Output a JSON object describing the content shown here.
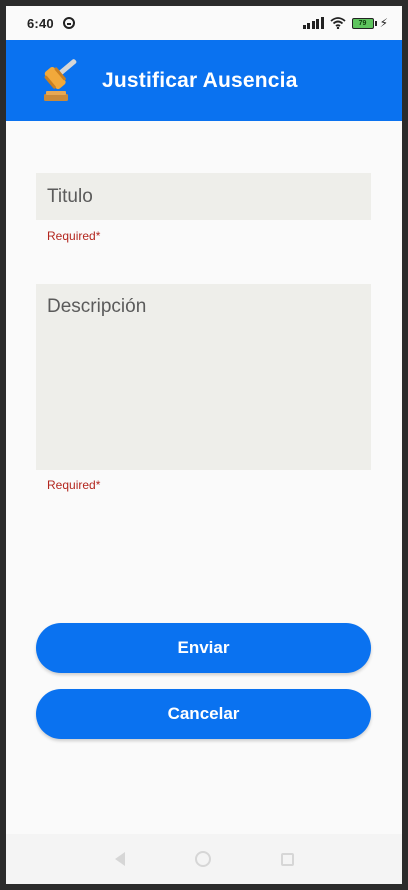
{
  "status_bar": {
    "time": "6:40",
    "battery_level": "79"
  },
  "app_bar": {
    "title": "Justificar Ausencia",
    "icon": "gavel-icon",
    "color": "#0a72f0"
  },
  "form": {
    "titulo_placeholder": "Titulo",
    "titulo_value": "",
    "titulo_helper": "Required*",
    "descripcion_placeholder": "Descripción",
    "descripcion_value": "",
    "descripcion_helper": "Required*"
  },
  "buttons": {
    "enviar": "Enviar",
    "cancelar": "Cancelar"
  },
  "colors": {
    "primary": "#0a72f0",
    "error": "#b3261e",
    "field_bg": "#eeeeea"
  }
}
